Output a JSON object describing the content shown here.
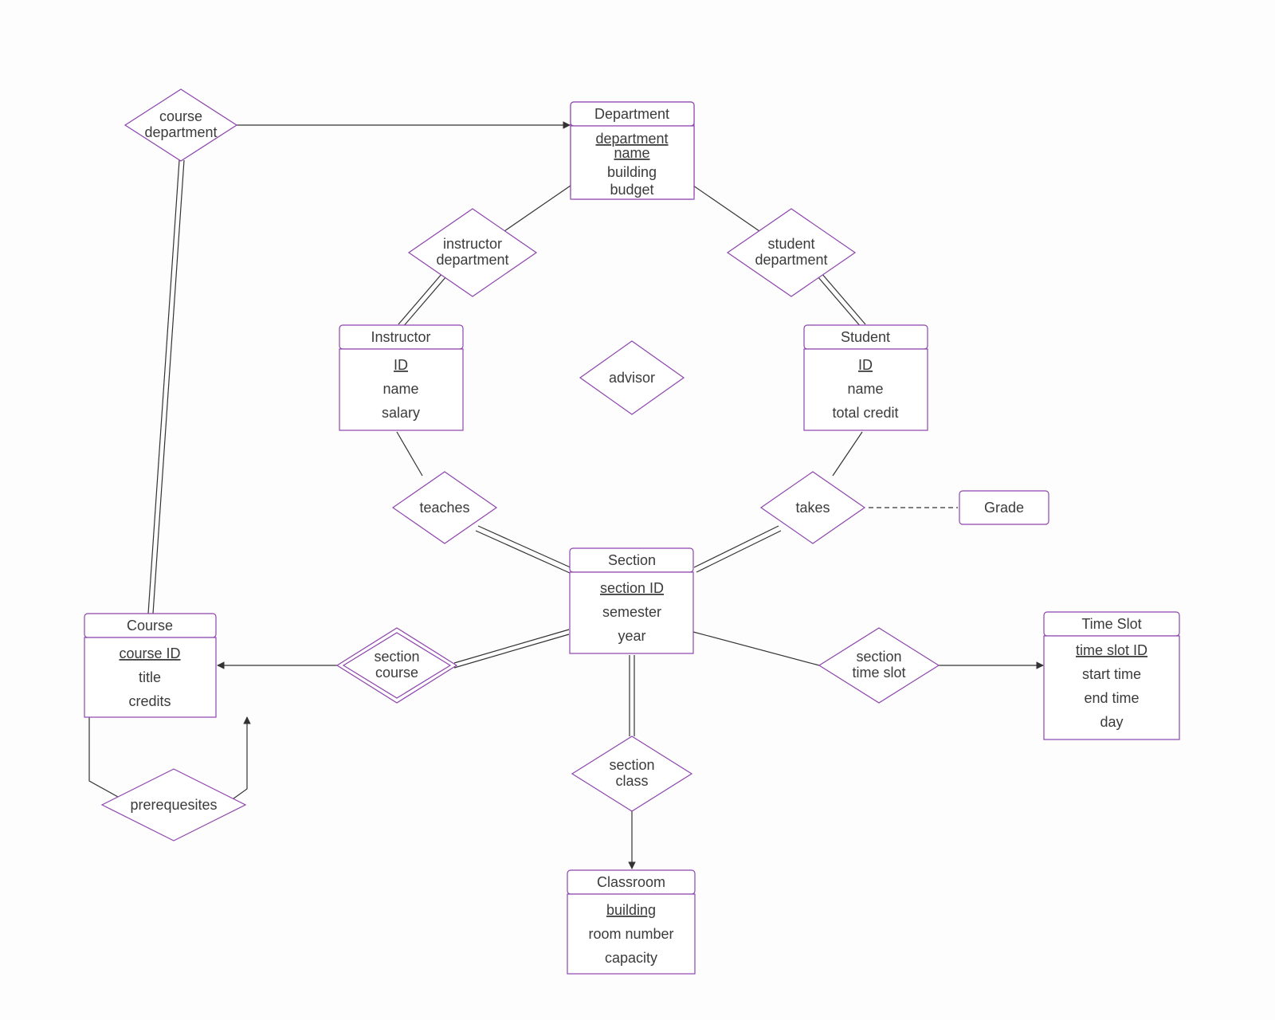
{
  "entities": {
    "department": {
      "title": "Department",
      "key": "department name",
      "attrs": [
        "building",
        "budget"
      ]
    },
    "instructor": {
      "title": "Instructor",
      "key": "ID",
      "attrs": [
        "name",
        "salary"
      ]
    },
    "student": {
      "title": "Student",
      "key": "ID",
      "attrs": [
        "name",
        "total credit"
      ]
    },
    "section": {
      "title": "Section",
      "key": "section ID",
      "attrs": [
        "semester",
        "year"
      ]
    },
    "course": {
      "title": "Course",
      "key": "course ID",
      "attrs": [
        "title",
        "credits"
      ]
    },
    "classroom": {
      "title": "Classroom",
      "key": "building",
      "attrs": [
        "room number",
        "capacity"
      ]
    },
    "timeslot": {
      "title": "Time Slot",
      "key": "time slot ID",
      "attrs": [
        "start time",
        "end time",
        "day"
      ]
    },
    "grade": {
      "title": "Grade"
    }
  },
  "relationships": {
    "course_department": {
      "l1": "course",
      "l2": "department"
    },
    "instructor_department": {
      "l1": "instructor",
      "l2": "department"
    },
    "student_department": {
      "l1": "student",
      "l2": "department"
    },
    "advisor": {
      "l1": "advisor"
    },
    "teaches": {
      "l1": "teaches"
    },
    "takes": {
      "l1": "takes"
    },
    "section_course": {
      "l1": "section",
      "l2": "course"
    },
    "section_time_slot": {
      "l1": "section",
      "l2": "time slot"
    },
    "section_class": {
      "l1": "section",
      "l2": "class"
    },
    "prerequisites": {
      "l1": "prerequesites"
    }
  }
}
